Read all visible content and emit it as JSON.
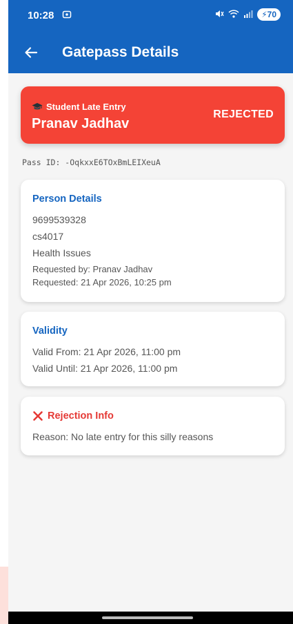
{
  "status_bar": {
    "time": "10:28",
    "battery": "70"
  },
  "app_bar": {
    "title": "Gatepass Details"
  },
  "header_card": {
    "type": "Student Late Entry",
    "name": "Pranav Jadhav",
    "status": "REJECTED",
    "bg_color": "#f44336"
  },
  "pass_id": "Pass ID: -OqkxxE6TOxBmLEIXeuA",
  "person_details": {
    "title": "Person Details",
    "phone": "9699539328",
    "roll": "cs4017",
    "reason": "Health Issues",
    "requested_by": "Requested by: Pranav Jadhav",
    "requested_at": "Requested: 21 Apr 2026, 10:25 pm"
  },
  "validity": {
    "title": "Validity",
    "valid_from": "Valid From: 21 Apr 2026, 11:00 pm",
    "valid_until": "Valid Until: 21 Apr 2026, 11:00 pm"
  },
  "rejection": {
    "title": "Rejection Info",
    "reason": "Reason: No late entry for this silly reasons"
  },
  "colors": {
    "primary": "#1565c0",
    "rejected": "#f44336",
    "rejection_title": "#e53935"
  }
}
